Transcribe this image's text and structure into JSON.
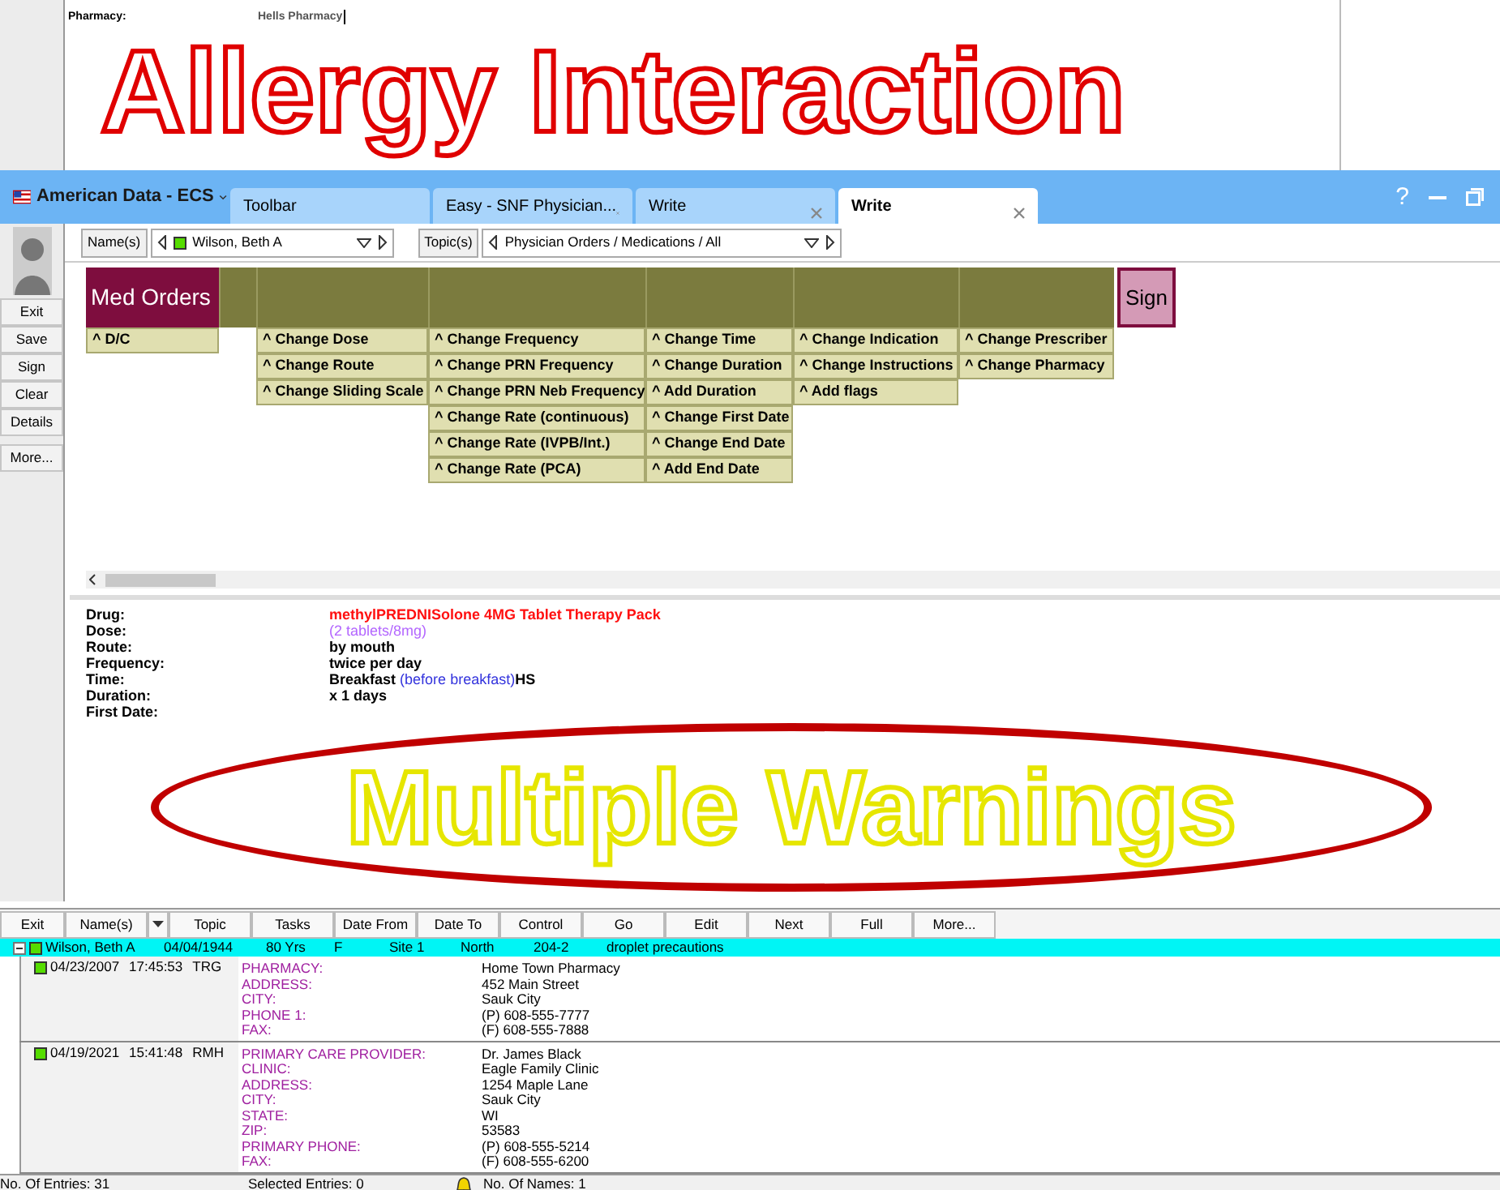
{
  "background_document": {
    "rows": [
      {
        "label": "Pharmacy:",
        "value": "Hells Pharmacy"
      }
    ]
  },
  "annotations": [
    {
      "kind": "banner",
      "text": "Allergy Interaction"
    },
    {
      "kind": "circled",
      "text": "Multiple Warnings"
    }
  ],
  "app": {
    "title": "American Data - ECS",
    "help": "?"
  },
  "tabs": [
    {
      "label": "Toolbar",
      "selected": false,
      "closable": false
    },
    {
      "label": "Easy - SNF Physician...",
      "selected": false,
      "closable": true
    },
    {
      "label": "Write",
      "selected": false,
      "closable": true
    },
    {
      "label": "Write",
      "selected": true,
      "closable": true
    }
  ],
  "selectors": [
    {
      "button": "Name(s)",
      "value": "Wilson, Beth A",
      "status": true
    },
    {
      "button": "Topic(s)",
      "value": "Physician Orders / Medications / All",
      "status": false
    }
  ],
  "side_buttons": [
    "Exit",
    "Save",
    "Sign",
    "Clear",
    "Details",
    "More..."
  ],
  "order_grid": {
    "title": "Med Orders",
    "sign": "Sign",
    "columns": [
      {
        "buttons": [
          "^ D/C"
        ]
      },
      {},
      {
        "buttons": [
          "^ Change Dose",
          "^ Change Route",
          "^ Change Sliding Scale"
        ]
      },
      {
        "buttons": [
          "^ Change Frequency",
          "^ Change PRN Frequency",
          "^ Change PRN Neb Frequency",
          "^ Change Rate (continuous)",
          "^ Change Rate (IVPB/Int.)",
          "^ Change Rate (PCA)"
        ]
      },
      {
        "buttons": [
          "^ Change Time",
          "^ Change Duration",
          "^ Add Duration",
          "^ Change First Date",
          "^ Change End Date",
          "^ Add End Date"
        ]
      },
      {
        "buttons": [
          "^ Change Indication",
          "^ Change Instructions",
          "^ Add flags"
        ]
      },
      {
        "buttons": [
          "^ Change Prescriber",
          "^ Change Pharmacy"
        ]
      }
    ]
  },
  "order_details": [
    {
      "label": "Drug:",
      "parts": [
        {
          "kind": "drug",
          "text": "methylPREDNISolone 4MG Tablet Therapy Pack"
        }
      ]
    },
    {
      "label": "Dose:",
      "parts": [
        {
          "kind": "dose",
          "text": "(2 tablets/8mg)"
        }
      ]
    },
    {
      "label": "Route:",
      "parts": [
        {
          "kind": "value",
          "text": "by mouth"
        }
      ]
    },
    {
      "label": "Frequency:",
      "parts": [
        {
          "kind": "value",
          "text": "twice per day"
        }
      ]
    },
    {
      "label": "Time:",
      "parts": [
        {
          "kind": "value",
          "text": "Breakfast"
        },
        {
          "kind": "note",
          "text": "(before breakfast)"
        },
        {
          "kind": "value",
          "text": "HS"
        }
      ]
    },
    {
      "label": "Duration:",
      "parts": [
        {
          "kind": "value",
          "text": "x 1 days"
        }
      ]
    },
    {
      "label": "First Date:"
    }
  ],
  "bottom_toolbar": [
    "Exit",
    "Name(s)",
    "Topic",
    "Tasks",
    "Date From",
    "Date To",
    "Control",
    "Go",
    "Edit",
    "Next",
    "Full",
    "More..."
  ],
  "patient": {
    "expanded": true,
    "selected": true,
    "cells": [
      "Wilson, Beth A",
      "04/04/1944",
      "80 Yrs",
      "F",
      "Site 1",
      "North",
      "204-2",
      "droplet precautions"
    ]
  },
  "entries": [
    {
      "date": "04/23/2007",
      "time": "17:45:53",
      "user": "TRG",
      "fields": [
        {
          "label": "PHARMACY:",
          "value": "Home Town Pharmacy"
        },
        {
          "label": "ADDRESS:",
          "value": "452 Main Street"
        },
        {
          "label": "CITY:",
          "value": "Sauk City"
        },
        {
          "label": "PHONE 1:",
          "value": "(P) 608-555-7777"
        },
        {
          "label": "FAX:",
          "value": "(F) 608-555-7888"
        }
      ]
    },
    {
      "date": "04/19/2021",
      "time": "15:41:48",
      "user": "RMH",
      "fields": [
        {
          "label": "PRIMARY CARE PROVIDER:",
          "value": "Dr. James Black"
        },
        {
          "label": "CLINIC:",
          "value": "Eagle Family Clinic"
        },
        {
          "label": "ADDRESS:",
          "value": "1254 Maple Lane"
        },
        {
          "label": "CITY:",
          "value": "Sauk City"
        },
        {
          "label": "STATE:",
          "value": "WI"
        },
        {
          "label": "ZIP:",
          "value": "53583"
        },
        {
          "label": "PRIMARY PHONE:",
          "value": "(P) 608-555-5214"
        },
        {
          "label": "FAX:",
          "value": "(F) 608-555-6200"
        }
      ]
    }
  ],
  "status_bar": {
    "entries": "No. Of Entries: 31",
    "selected": "Selected Entries: 0",
    "names": "No. Of Names: 1"
  }
}
